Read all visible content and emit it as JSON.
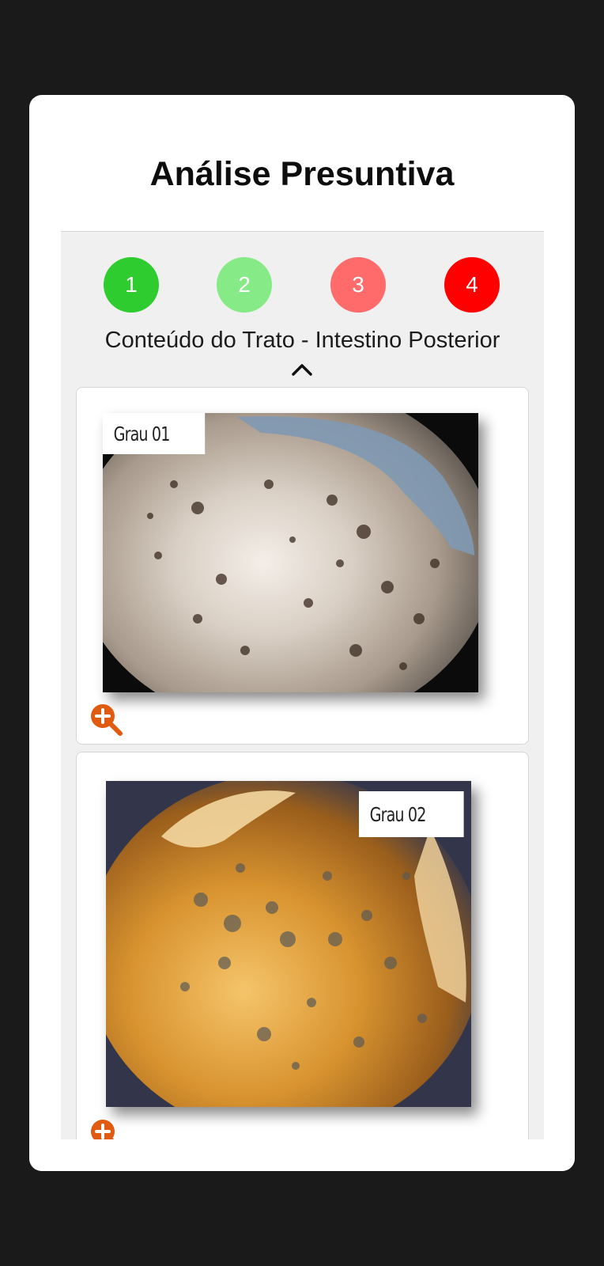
{
  "modal": {
    "title": "Análise Presuntiva",
    "section_title": "Conteúdo do Trato - Intestino Posterior"
  },
  "grades": [
    {
      "label": "1",
      "color": "#2ecc2e"
    },
    {
      "label": "2",
      "color": "#86ea86"
    },
    {
      "label": "3",
      "color": "#ff6b6b"
    },
    {
      "label": "4",
      "color": "#ff0000"
    }
  ],
  "icons": {
    "collapse": "chevron-up-icon",
    "zoom": "zoom-in-icon"
  },
  "accent_color": "#e05a10",
  "images": [
    {
      "tag": "Grau 01"
    },
    {
      "tag": "Grau 02"
    }
  ]
}
